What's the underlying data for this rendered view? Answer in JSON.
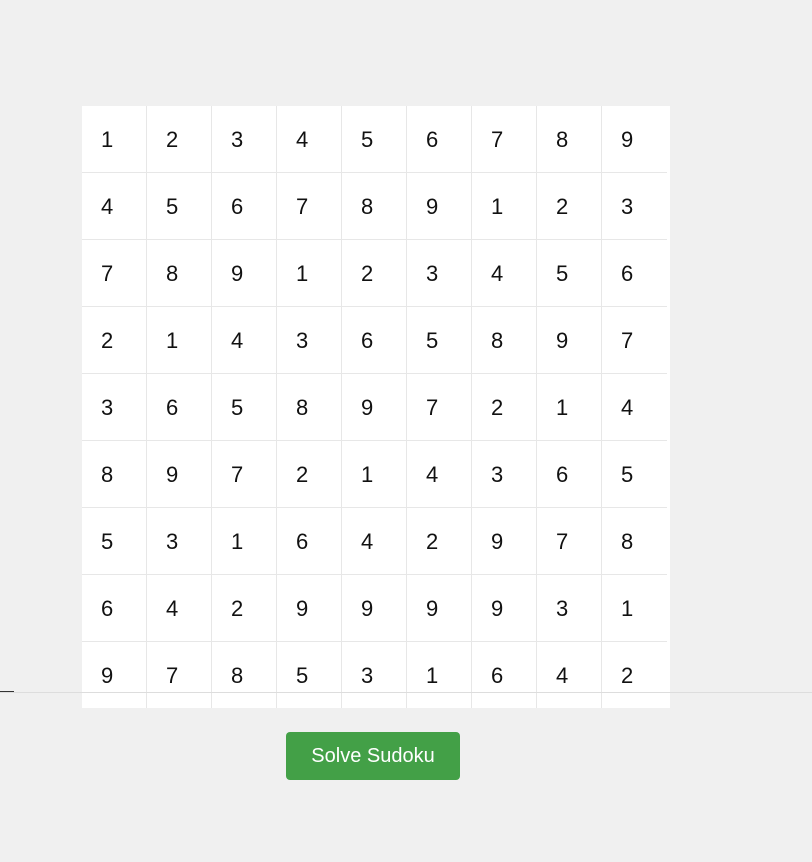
{
  "board": {
    "rows": [
      [
        "1",
        "2",
        "3",
        "4",
        "5",
        "6",
        "7",
        "8",
        "9"
      ],
      [
        "4",
        "5",
        "6",
        "7",
        "8",
        "9",
        "1",
        "2",
        "3"
      ],
      [
        "7",
        "8",
        "9",
        "1",
        "2",
        "3",
        "4",
        "5",
        "6"
      ],
      [
        "2",
        "1",
        "4",
        "3",
        "6",
        "5",
        "8",
        "9",
        "7"
      ],
      [
        "3",
        "6",
        "5",
        "8",
        "9",
        "7",
        "2",
        "1",
        "4"
      ],
      [
        "8",
        "9",
        "7",
        "2",
        "1",
        "4",
        "3",
        "6",
        "5"
      ],
      [
        "5",
        "3",
        "1",
        "6",
        "4",
        "2",
        "9",
        "7",
        "8"
      ],
      [
        "6",
        "4",
        "2",
        "9",
        "9",
        "9",
        "9",
        "3",
        "1"
      ],
      [
        "9",
        "7",
        "8",
        "5",
        "3",
        "1",
        "6",
        "4",
        "2"
      ]
    ]
  },
  "actions": {
    "solve_label": "Solve Sudoku"
  },
  "colors": {
    "background": "#f0f0f0",
    "cell_background": "#ffffff",
    "grid_line": "#e7e7e7",
    "button": "#43a047"
  }
}
